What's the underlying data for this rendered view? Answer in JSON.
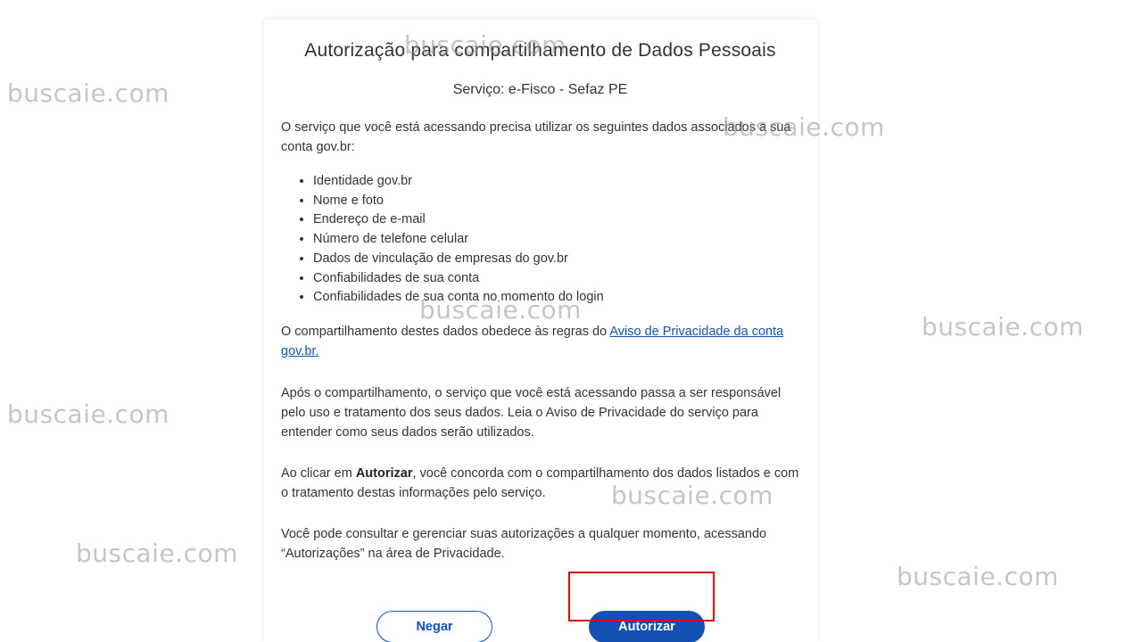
{
  "dialog": {
    "title": "Autorização para compartilhamento de Dados Pessoais",
    "service": "Serviço: e-Fisco - Sefaz PE",
    "intro": "O serviço que você está acessando precisa utilizar os seguintes dados associados a sua conta gov.br:",
    "data_items": [
      "Identidade gov.br",
      "Nome e foto",
      "Endereço de e-mail",
      "Número de telefone celular",
      "Dados de vinculação de empresas do gov.br",
      "Confiabilidades de sua conta",
      "Confiabilidades de sua conta no momento do login"
    ],
    "sharing_prefix": "O compartilhamento destes dados obedece às regras do ",
    "sharing_link": "Aviso de Privacidade da conta gov.br.",
    "after_sharing": "Após o compartilhamento, o serviço que você está acessando passa a ser responsável pelo uso e tratamento dos seus dados. Leia o Aviso de Privacidade do serviço para entender como seus dados serão utilizados.",
    "consent_prefix": "Ao clicar em ",
    "consent_bold": "Autorizar",
    "consent_suffix": ", você concorda com o compartilhamento dos dados listados e com o tratamento destas informações pelo serviço.",
    "manage": "Você pode consultar e gerenciar suas autorizações a qualquer momento, acessando “Autorizações” na área de Privacidade.",
    "deny_label": "Negar",
    "authorize_label": "Autorizar"
  },
  "watermark": "buscaie.com",
  "colors": {
    "primary": "#1351b4",
    "highlight": "#e00000",
    "text": "#333333"
  }
}
